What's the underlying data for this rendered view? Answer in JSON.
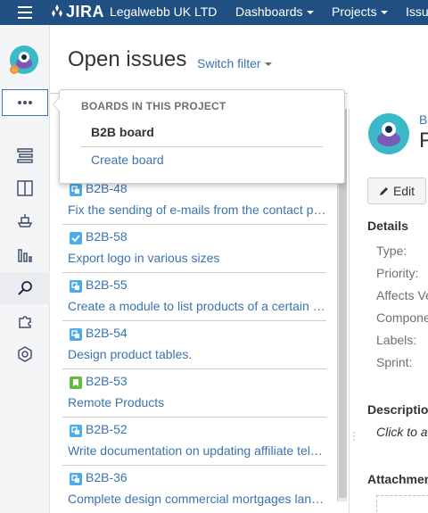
{
  "topnav": {
    "logo_text": "JIRA",
    "items": [
      {
        "label": "Legalwebb UK LTD"
      },
      {
        "label": "Dashboards"
      },
      {
        "label": "Projects"
      },
      {
        "label": "Issu"
      }
    ]
  },
  "header": {
    "title": "Open issues",
    "switch_filter": "Switch filter"
  },
  "dropdown": {
    "heading": "BOARDS IN THIS PROJECT",
    "board_item": "B2B board",
    "create_board": "Create board"
  },
  "issues": [
    {
      "key": "B2B-48",
      "type": "subtask",
      "summary": "Fix the sending of e-mails from the contact page"
    },
    {
      "key": "B2B-58",
      "type": "task",
      "summary": "Export logo in various sizes"
    },
    {
      "key": "B2B-55",
      "type": "subtask",
      "summary": "Create a module to list products of a certain category"
    },
    {
      "key": "B2B-54",
      "type": "subtask",
      "summary": "Design product tables."
    },
    {
      "key": "B2B-53",
      "type": "story",
      "summary": "Remote Products"
    },
    {
      "key": "B2B-52",
      "type": "subtask",
      "summary": "Write documentation on updating affiliate telephone numbers"
    },
    {
      "key": "B2B-36",
      "type": "subtask",
      "summary": "Complete design commercial mortgages landing page"
    }
  ],
  "detail": {
    "project_link": "B",
    "title": "F",
    "edit_label": "Edit",
    "details_heading": "Details",
    "fields": [
      {
        "label": "Type:"
      },
      {
        "label": "Priority:"
      },
      {
        "label": "Affects Ve"
      },
      {
        "label": "Compone"
      },
      {
        "label": "Labels:"
      },
      {
        "label": "Sprint:"
      }
    ],
    "description_heading": "Descriptio",
    "description_text": "Click to a",
    "attachments_heading": "Attachmen"
  },
  "colors": {
    "nav_bg": "#205081",
    "link": "#3b73af",
    "subtask": "#4bade8",
    "task": "#4bade8",
    "story": "#63ba3c"
  }
}
